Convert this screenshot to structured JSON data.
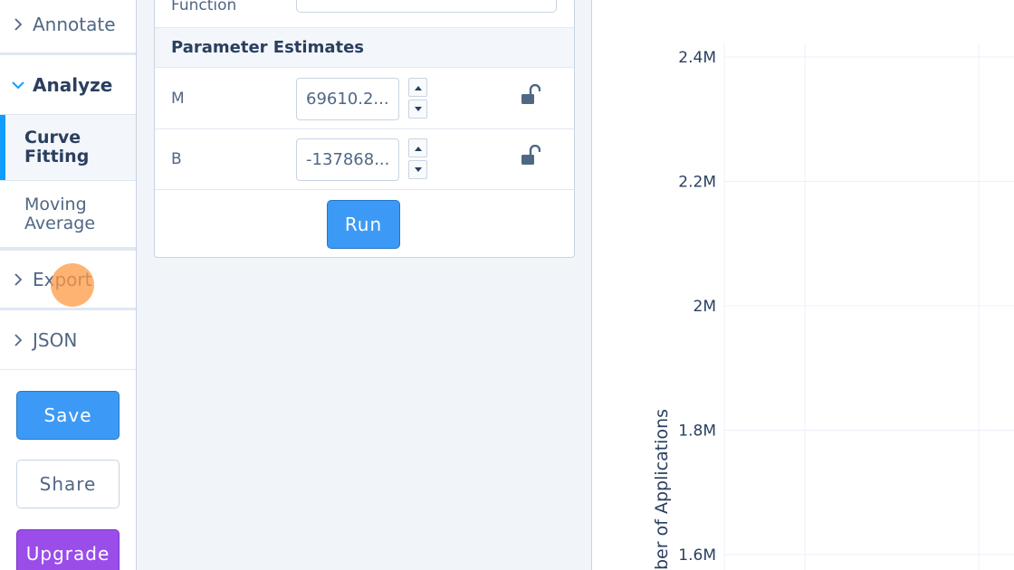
{
  "sidebar": {
    "annotate_label": "Annotate",
    "analyze_label": "Analyze",
    "analyze_items": [
      {
        "label_line1": "Curve",
        "label_line2": "Fitting"
      },
      {
        "label_line1": "Moving",
        "label_line2": "Average"
      }
    ],
    "export_label": "Export",
    "json_label": "JSON",
    "save_label": "Save",
    "share_label": "Share",
    "upgrade_label": "Upgrade"
  },
  "panel": {
    "function_label": "Function",
    "section_title": "Parameter Estimates",
    "params": [
      {
        "name": "M",
        "value": "69610.2..."
      },
      {
        "name": "B",
        "value": "-137868..."
      }
    ],
    "run_label": "Run"
  },
  "chart_data": {
    "type": "line",
    "ylabel": "ber of Applications",
    "y_ticks": [
      {
        "value": 2400000,
        "label": "2.4M"
      },
      {
        "value": 2200000,
        "label": "2.2M"
      },
      {
        "value": 2000000,
        "label": "2M"
      },
      {
        "value": 1800000,
        "label": "1.8M"
      },
      {
        "value": 1600000,
        "label": "1.6M"
      }
    ],
    "grid": true,
    "series": []
  },
  "colors": {
    "accent": "#3c9af6",
    "upgrade": "#9b4dea",
    "active_bar": "#119dff",
    "cursor": "#ff9944"
  }
}
